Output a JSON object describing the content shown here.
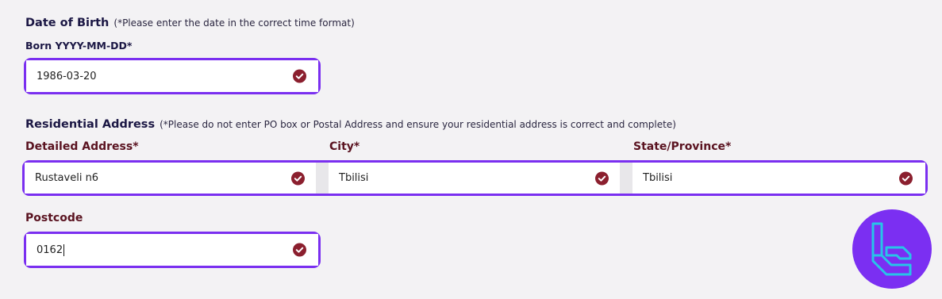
{
  "dob": {
    "title": "Date of Birth",
    "hint": "(*Please enter the date in the correct time format)",
    "label": "Born YYYY-MM-DD*",
    "value": "1986-03-20"
  },
  "address": {
    "title": "Residential Address",
    "hint": "(*Please do not enter PO box or Postal Address and ensure your residential address is correct and complete)",
    "detailed_label": "Detailed Address*",
    "detailed_value": "Rustaveli n6",
    "city_label": "City*",
    "city_value": "Tbilisi",
    "state_label": "State/Province*",
    "state_value": "Tbilisi"
  },
  "postcode": {
    "label": "Postcode",
    "value": "0162"
  },
  "icons": {
    "valid": "check-circle-icon",
    "brand": "brand-logo-icon"
  },
  "colors": {
    "focus_border": "#7a2ff0",
    "check": "#8b1f2e",
    "field_label": "#5a1320",
    "logo_bg": "#7b2ff2",
    "logo_glyph": "#27c4e8"
  }
}
